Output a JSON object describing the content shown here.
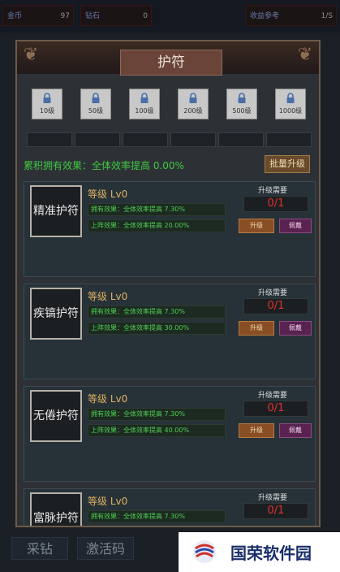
{
  "topbar": {
    "gold": {
      "label": "金币",
      "value": "97"
    },
    "diamond": {
      "label": "钻石",
      "value": "0"
    },
    "income": {
      "label": "收益参考",
      "value": "1/S"
    }
  },
  "panel": {
    "title": "护符",
    "locks": [
      "10级",
      "50级",
      "100级",
      "200级",
      "500级",
      "1000级"
    ],
    "cumulative": "累积拥有效果：全体效率提高 0.00%",
    "batch_button": "批量升级"
  },
  "amulets": [
    {
      "name": "精准护符",
      "level": "等级 Lv0",
      "own": "拥有效果：全体效率提高 7.30%",
      "equip": "上阵效果：全体效率提高 20.00%",
      "req_label": "升级需要",
      "count": "0/1",
      "upgrade": "升级",
      "wear": "佩戴"
    },
    {
      "name": "疾镐护符",
      "level": "等级 Lv0",
      "own": "拥有效果：全体效率提高 7.30%",
      "equip": "上阵效果：全体效率提高 30.00%",
      "req_label": "升级需要",
      "count": "0/1",
      "upgrade": "升级",
      "wear": "佩戴"
    },
    {
      "name": "无倦护符",
      "level": "等级 Lv0",
      "own": "拥有效果：全体效率提高 7.30%",
      "equip": "上阵效果：全体效率提高 40.00%",
      "req_label": "升级需要",
      "count": "0/1",
      "upgrade": "升级",
      "wear": "佩戴"
    },
    {
      "name": "富脉护符",
      "level": "等级 Lv0",
      "own": "拥有效果：全体效率提高 7.30%",
      "req_label": "升级需要",
      "count": "0/1"
    }
  ],
  "bottom": {
    "mine": "采钻",
    "activate": "激活码"
  },
  "watermark": "国荣软件园",
  "colors": {
    "accent_green": "#40c840",
    "count_red": "#e03030",
    "upgrade_brown": "#8a4e24",
    "wear_purple": "#5a2250"
  }
}
